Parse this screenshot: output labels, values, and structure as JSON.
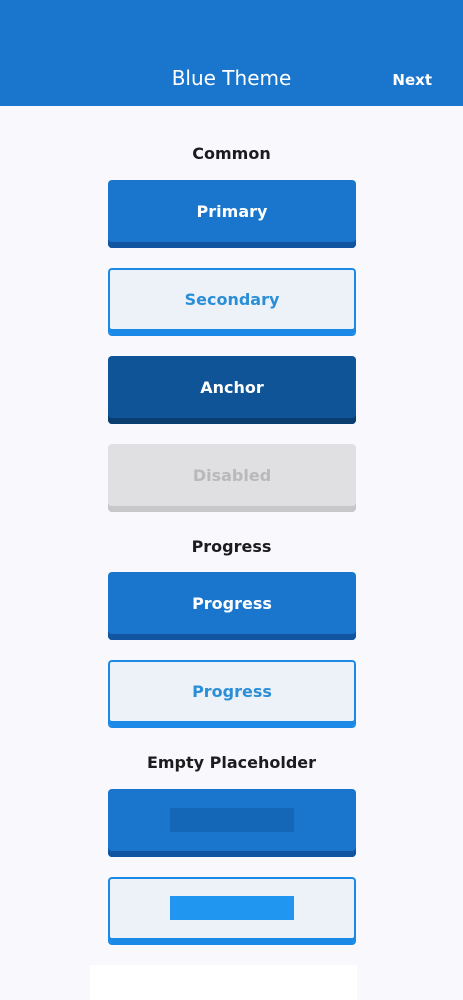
{
  "header": {
    "title": "Blue Theme",
    "next_label": "Next"
  },
  "sections": {
    "common": {
      "title": "Common",
      "primary_label": "Primary",
      "secondary_label": "Secondary",
      "anchor_label": "Anchor",
      "disabled_label": "Disabled"
    },
    "progress": {
      "title": "Progress",
      "primary_label": "Progress",
      "secondary_label": "Progress"
    },
    "empty_placeholder": {
      "title": "Empty Placeholder"
    }
  },
  "colors": {
    "header_bg": "#1976cc",
    "primary": "#1976cc",
    "anchor": "#0e5496",
    "secondary_border": "#1a8ae6",
    "disabled": "#e0dfe2"
  }
}
